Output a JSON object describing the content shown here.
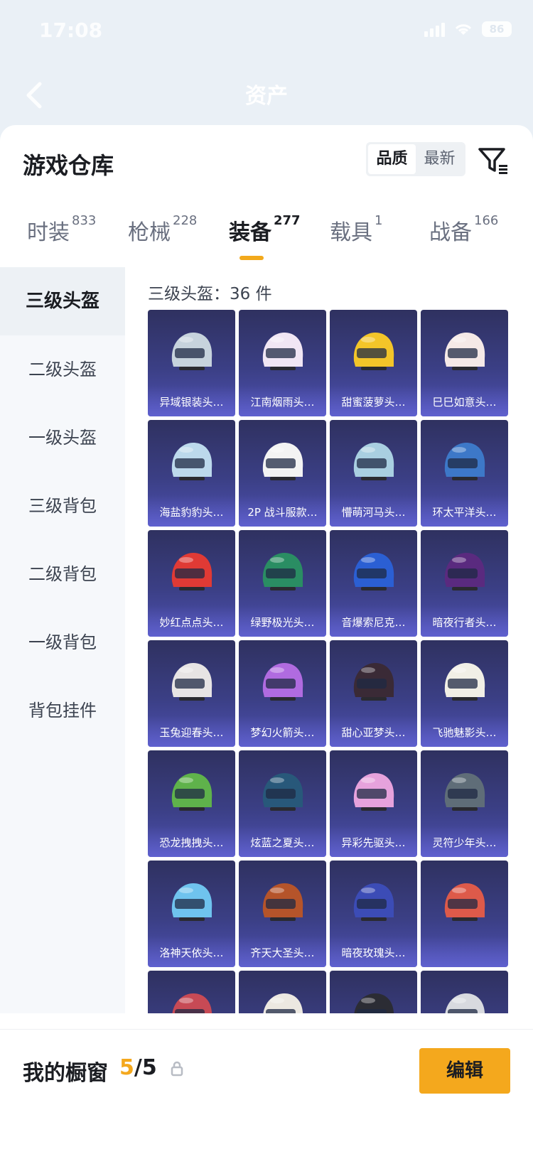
{
  "status_bar": {
    "time": "17:08",
    "battery": "86"
  },
  "header": {
    "title": "资产"
  },
  "sheet": {
    "title": "游戏仓库",
    "sort_options": [
      "品质",
      "最新"
    ],
    "active_sort": "品质"
  },
  "tabs": [
    {
      "label": "时装",
      "count": "833"
    },
    {
      "label": "枪械",
      "count": "228"
    },
    {
      "label": "装备",
      "count": "277"
    },
    {
      "label": "载具",
      "count": "1"
    },
    {
      "label": "战备",
      "count": "166"
    }
  ],
  "sidebar": {
    "items": [
      "三级头盔",
      "二级头盔",
      "一级头盔",
      "三级背包",
      "二级背包",
      "一级背包",
      "背包挂件"
    ]
  },
  "grid": {
    "heading": "三级头盔：36 件",
    "items": [
      {
        "label": "异域银装头…",
        "color": "#c7d3dd"
      },
      {
        "label": "江南烟雨头…",
        "color": "#f1e6f4"
      },
      {
        "label": "甜蜜菠萝头…",
        "color": "#f3c529"
      },
      {
        "label": "巳巳如意头…",
        "color": "#f5e9e7"
      },
      {
        "label": "海盐豹豹头…",
        "color": "#bcd9ec"
      },
      {
        "label": "2P 战斗服款…",
        "color": "#f3f3f3"
      },
      {
        "label": "懵萌河马头…",
        "color": "#a9cfe1"
      },
      {
        "label": "环太平洋头…",
        "color": "#3d78c8"
      },
      {
        "label": "妙红点点头…",
        "color": "#e03a35"
      },
      {
        "label": "绿野极光头…",
        "color": "#2a8d63"
      },
      {
        "label": "音爆索尼克…",
        "color": "#2b5fd3"
      },
      {
        "label": "暗夜行者头…",
        "color": "#5a2a7f"
      },
      {
        "label": "玉兔迎春头…",
        "color": "#e7e4e4"
      },
      {
        "label": "梦幻火箭头…",
        "color": "#b06be0"
      },
      {
        "label": "甜心亚梦头…",
        "color": "#3a2a36"
      },
      {
        "label": "飞驰魅影头…",
        "color": "#f1efe6"
      },
      {
        "label": "恐龙拽拽头…",
        "color": "#5fb24b"
      },
      {
        "label": "炫蓝之夏头…",
        "color": "#28587a"
      },
      {
        "label": "异彩先驱头…",
        "color": "#e6a2dc"
      },
      {
        "label": "灵符少年头…",
        "color": "#5f6d78"
      },
      {
        "label": "洛神天依头…",
        "color": "#6fc3ee"
      },
      {
        "label": "齐天大圣头…",
        "color": "#b5542a"
      },
      {
        "label": "暗夜玫瑰头…",
        "color": "#3c4cb6"
      },
      {
        "label": "",
        "color": "#dd5a4a"
      },
      {
        "label": "",
        "color": "#c74a55"
      },
      {
        "label": "",
        "color": "#ece8e1"
      },
      {
        "label": "",
        "color": "#2b2c34"
      },
      {
        "label": "",
        "color": "#d8dadf"
      }
    ]
  },
  "bottom_bar": {
    "label": "我的橱窗",
    "count_current": "5",
    "count_total": "/5",
    "edit_label": "编辑"
  },
  "colors": {
    "accent": "#f4a81d",
    "card_bg": "#3b3f85"
  }
}
